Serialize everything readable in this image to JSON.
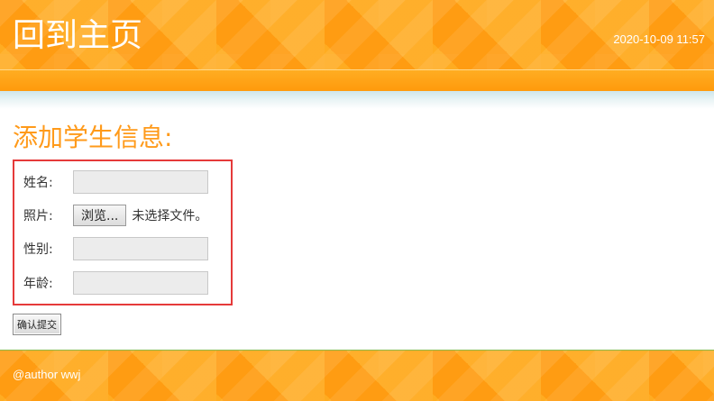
{
  "header": {
    "home_link": "回到主页",
    "datetime": "2020-10-09 11:57"
  },
  "main": {
    "title": "添加学生信息:",
    "form": {
      "name_label": "姓名:",
      "name_value": "",
      "photo_label": "照片:",
      "browse_button": "浏览...",
      "file_status": "未选择文件。",
      "gender_label": "性别:",
      "gender_value": "",
      "age_label": "年龄:",
      "age_value": "",
      "submit_button": "确认提交"
    }
  },
  "footer": {
    "author": "@author wwj"
  },
  "colors": {
    "brand_orange": "#ff9c12",
    "title_orange": "#ff9a1a",
    "form_border_red": "#e53a3a"
  }
}
